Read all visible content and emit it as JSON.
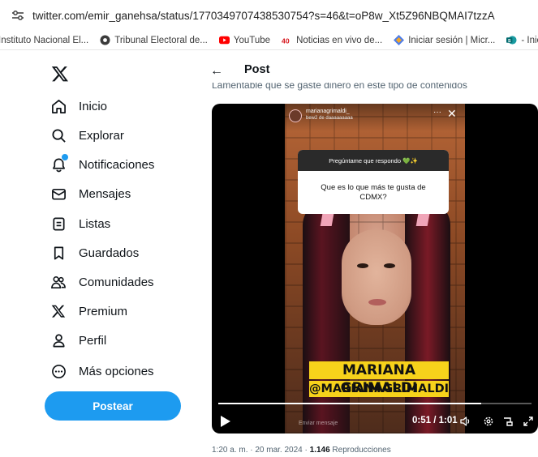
{
  "browser": {
    "url_host": "twitter.com",
    "url_path": "/emir_ganehsa/status/1770349707438530754?s=46&t=oP8w_Xt5Z96NBQMAI7tzzA"
  },
  "bookmarks": [
    {
      "label": "Instituto Nacional El...",
      "icon": "globe-icon"
    },
    {
      "label": "Tribunal Electoral de...",
      "icon": "tribunal-icon"
    },
    {
      "label": "YouTube",
      "icon": "youtube-icon"
    },
    {
      "label": "Noticias en vivo de...",
      "icon": "noticias-icon"
    },
    {
      "label": "Iniciar sesión | Micr...",
      "icon": "microsoft-icon"
    },
    {
      "label": "- Inicio",
      "icon": "sharepoint-icon"
    }
  ],
  "nav": {
    "items": [
      {
        "label": "Inicio",
        "icon": "home-icon"
      },
      {
        "label": "Explorar",
        "icon": "search-icon"
      },
      {
        "label": "Notificaciones",
        "icon": "bell-icon"
      },
      {
        "label": "Mensajes",
        "icon": "mail-icon"
      },
      {
        "label": "Listas",
        "icon": "list-icon"
      },
      {
        "label": "Guardados",
        "icon": "bookmark-icon"
      },
      {
        "label": "Comunidades",
        "icon": "communities-icon"
      },
      {
        "label": "Premium",
        "icon": "x-logo-icon"
      },
      {
        "label": "Perfil",
        "icon": "person-icon"
      },
      {
        "label": "Más opciones",
        "icon": "more-circle-icon"
      }
    ],
    "post_button": "Postear"
  },
  "colors": {
    "accent": "#1d9bf0",
    "text": "#0f1419",
    "muted": "#536471",
    "highlight": "#f7d21b"
  },
  "post": {
    "header_title": "Post",
    "text": "Lamentable que se gaste dinero en este tipo de contenidos",
    "video": {
      "ig_username": "marianagrimaldi_",
      "ig_subtitle": "bew2 de daaaaaaaaa",
      "question_header": "Pregúntame que respondo 💚✨",
      "question": "Que es lo que más te gusta de CDMX?",
      "name_line1": "MARIANA GRIMALDI",
      "name_line2": "@MARIANAGRIMALDI",
      "reply_placeholder": "Enviar mensaje",
      "time": "0:51 / 1:01",
      "progress_fraction": 0.84
    },
    "meta_time": "1:20 a. m. · 20 mar. 2024 · ",
    "views_count": "1.146",
    "views_label": " Reproducciones"
  }
}
